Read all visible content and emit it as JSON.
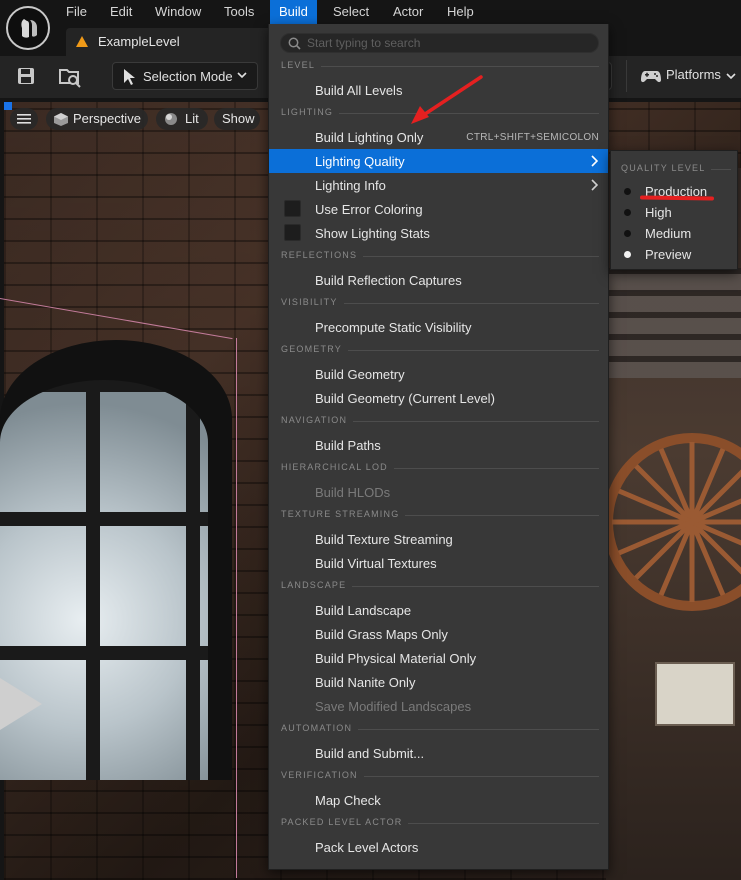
{
  "menubar": {
    "items": [
      {
        "label": "File"
      },
      {
        "label": "Edit"
      },
      {
        "label": "Window"
      },
      {
        "label": "Tools"
      },
      {
        "label": "Build"
      },
      {
        "label": "Select"
      },
      {
        "label": "Actor"
      },
      {
        "label": "Help"
      }
    ],
    "active": "Build"
  },
  "tab": {
    "label": "ExampleLevel"
  },
  "toolbar": {
    "selection_mode_label": "Selection Mode",
    "platforms_label": "Platforms"
  },
  "viewport": {
    "perspective_label": "Perspective",
    "lit_label": "Lit",
    "show_label": "Show"
  },
  "build_menu": {
    "search_placeholder": "Start typing to search",
    "sections": {
      "level": "LEVEL",
      "lighting": "LIGHTING",
      "reflections": "REFLECTIONS",
      "visibility": "VISIBILITY",
      "geometry": "GEOMETRY",
      "navigation": "NAVIGATION",
      "hlod": "HIERARCHICAL LOD",
      "texture_streaming": "TEXTURE STREAMING",
      "landscape": "LANDSCAPE",
      "automation": "AUTOMATION",
      "verification": "VERIFICATION",
      "packed_level_actor": "PACKED LEVEL ACTOR"
    },
    "items": {
      "build_all_levels": "Build All Levels",
      "build_lighting_only": "Build Lighting Only",
      "build_lighting_shortcut": "CTRL+SHIFT+SEMICOLON",
      "lighting_quality": "Lighting Quality",
      "lighting_info": "Lighting Info",
      "use_error_coloring": "Use Error Coloring",
      "show_lighting_stats": "Show Lighting Stats",
      "build_reflection_captures": "Build Reflection Captures",
      "precompute_static_visibility": "Precompute Static Visibility",
      "build_geometry": "Build Geometry",
      "build_geometry_current": "Build Geometry (Current Level)",
      "build_paths": "Build Paths",
      "build_hlods": "Build HLODs",
      "build_texture_streaming": "Build Texture Streaming",
      "build_virtual_textures": "Build Virtual Textures",
      "build_landscape": "Build Landscape",
      "build_grass_maps_only": "Build Grass Maps Only",
      "build_physical_material_only": "Build Physical Material Only",
      "build_nanite_only": "Build Nanite Only",
      "save_modified_landscapes": "Save Modified Landscapes",
      "build_and_submit": "Build and Submit...",
      "map_check": "Map Check",
      "pack_level_actors": "Pack Level Actors"
    }
  },
  "quality_menu": {
    "section": "QUALITY LEVEL",
    "options": [
      "Production",
      "High",
      "Medium",
      "Preview"
    ],
    "selected": "Preview"
  },
  "colors": {
    "accent": "#0b6fd8",
    "annotation": "#e52020"
  }
}
